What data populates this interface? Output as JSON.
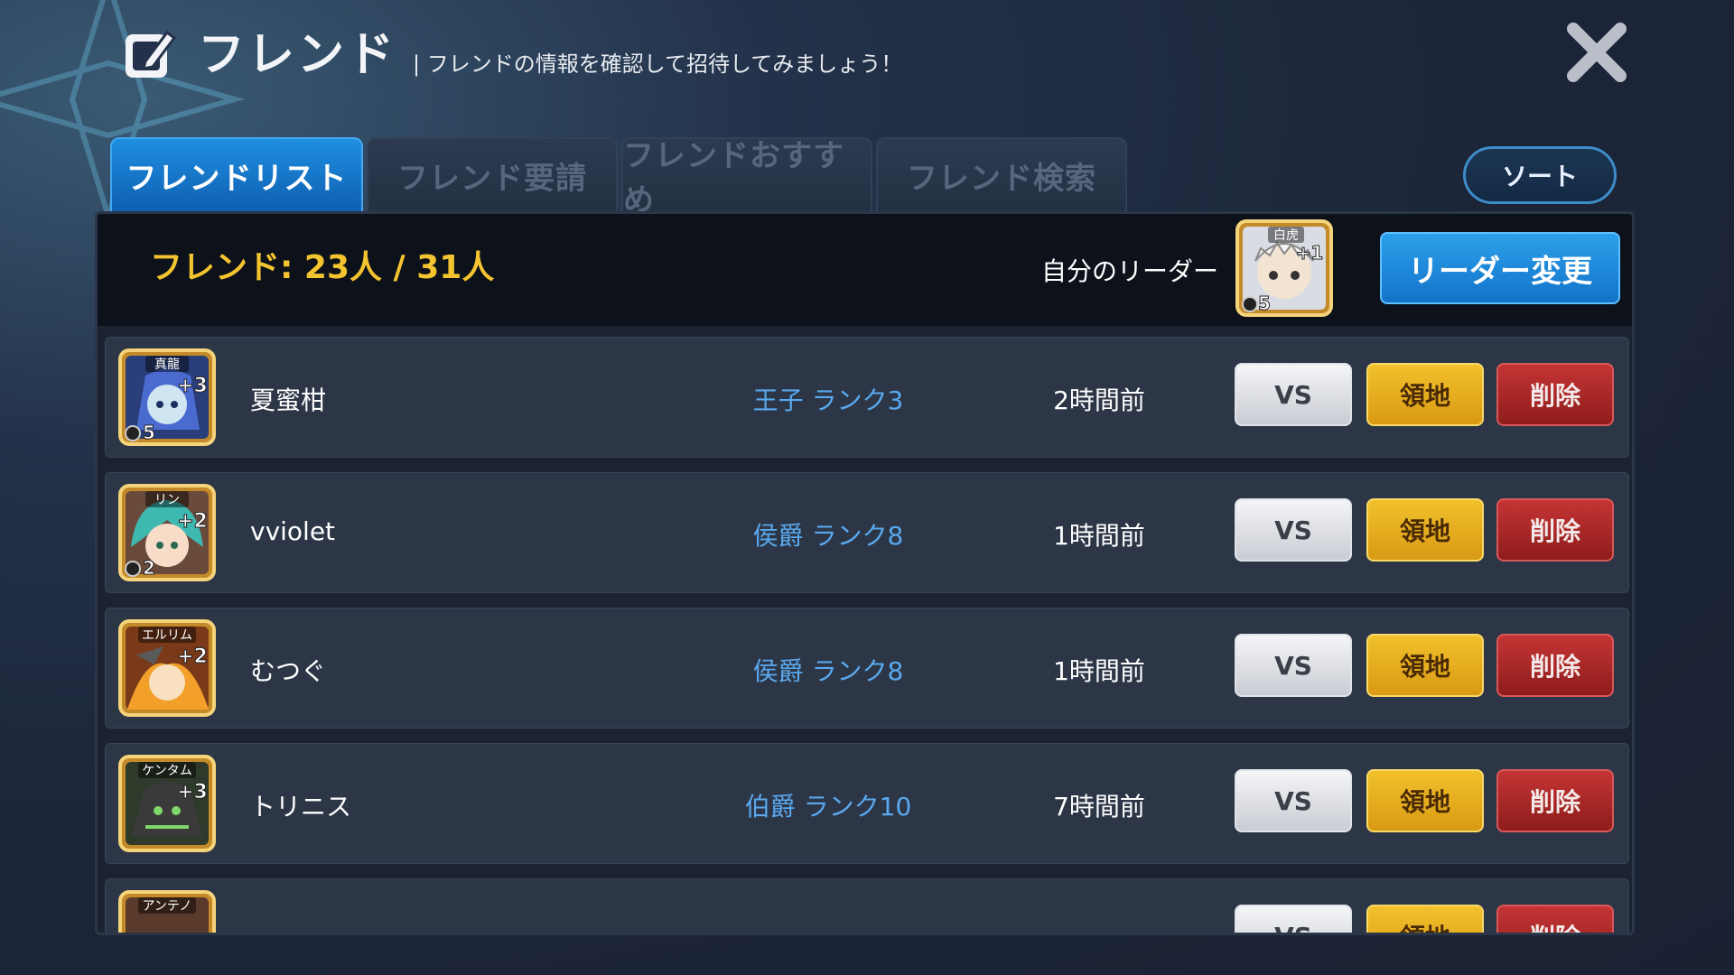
{
  "header": {
    "title": "フレンド",
    "subtitle": "フレンドの情報を確認して招待してみましょう！"
  },
  "tabs": [
    {
      "label": "フレンドリスト",
      "active": true
    },
    {
      "label": "フレンド要請",
      "active": false
    },
    {
      "label": "フレンドおすすめ",
      "active": false
    },
    {
      "label": "フレンド検索",
      "active": false
    }
  ],
  "sort_label": "ソート",
  "info": {
    "friend_count": "フレンド: 23人 / 31人",
    "leader_label": "自分のリーダー",
    "leader_avatar": {
      "name": "白虎",
      "plus": "+1",
      "level": "5"
    },
    "leader_change_label": "リーダー変更"
  },
  "buttons": {
    "vs": "VS",
    "territory": "領地",
    "delete": "削除"
  },
  "friends": [
    {
      "avatar_name": "真龍",
      "plus": "+3",
      "level": "5",
      "name": "夏蜜柑",
      "rank": "王子 ランク3",
      "last_login": "2時間前"
    },
    {
      "avatar_name": "リン",
      "plus": "+2",
      "level": "2",
      "name": "vviolet",
      "rank": "侯爵 ランク8",
      "last_login": "1時間前"
    },
    {
      "avatar_name": "エルリム",
      "plus": "+2",
      "level": "",
      "name": "むつぐ",
      "rank": "侯爵 ランク8",
      "last_login": "1時間前"
    },
    {
      "avatar_name": "ケンタム",
      "plus": "+3",
      "level": "",
      "name": "トリニス",
      "rank": "伯爵 ランク10",
      "last_login": "7時間前"
    },
    {
      "avatar_name": "アンテノ",
      "plus": "",
      "level": "",
      "name": "",
      "rank": "",
      "last_login": ""
    }
  ],
  "colors": {
    "accent_blue": "#1f8fe0",
    "gold_text": "#f4c430",
    "rank_blue": "#5aa8ee",
    "land_button": "#f2c12c",
    "delete_button": "#c53434"
  },
  "icons": [
    "edit-icon",
    "close-icon"
  ]
}
